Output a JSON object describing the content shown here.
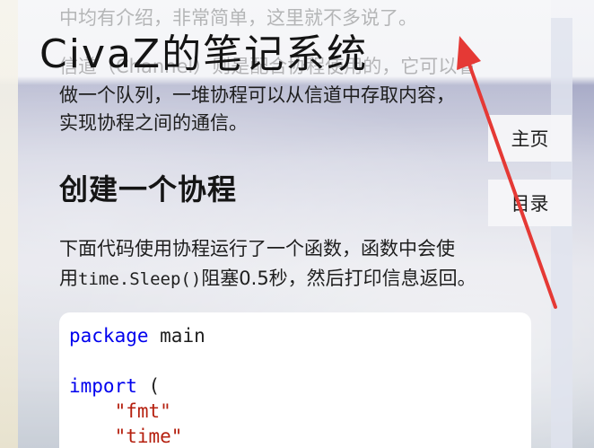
{
  "header": {
    "logo_text": "CivaZ的笔记系统"
  },
  "nav": {
    "home_label": "主页",
    "toc_label": "目录"
  },
  "article": {
    "intro_partial": "中均有介绍，非常简单，这里就不多说了。",
    "channel_line1": "信道（Channel）则是配合协程使用的，它可以看",
    "channel_line2": "做一个队列，一堆协程可以从信道中存取内容，",
    "channel_line3": "实现协程之间的通信。",
    "section_heading": "创建一个协程",
    "desc_line1": "下面代码使用协程运行了一个函数，函数中会使",
    "desc_line2_prefix": "用",
    "desc_line2_code": "time.Sleep()",
    "desc_line2_suffix": "阻塞0.5秒，然后打印信息返回。"
  },
  "code": {
    "line1_kw": "package",
    "line1_rest": " main",
    "line3_kw": "import",
    "line3_rest": " (",
    "line4_str": "\"fmt\"",
    "line5_str": "\"time\""
  },
  "colors": {
    "keyword": "#0000ee",
    "string": "#b5200f",
    "annotation_arrow": "#e53935"
  }
}
